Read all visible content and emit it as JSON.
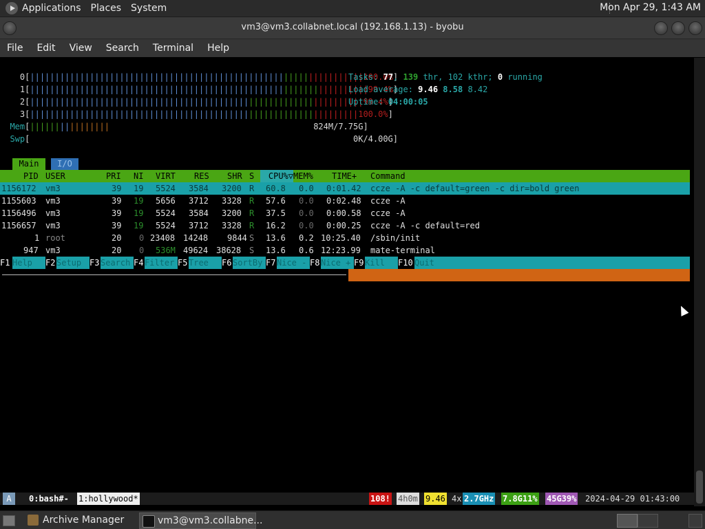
{
  "top_panel": {
    "menus": [
      "Applications",
      "Places",
      "System"
    ],
    "clock": "Mon Apr 29, 1:43 AM"
  },
  "window": {
    "title": "vm3@vm3.collabnet.local (192.168.1.13) - byobu"
  },
  "menubar": [
    "File",
    "Edit",
    "View",
    "Search",
    "Terminal",
    "Help"
  ],
  "htop": {
    "cpu_meters": [
      {
        "id": "0",
        "percent": "100.0%"
      },
      {
        "id": "1",
        "percent": "99.4%"
      },
      {
        "id": "2",
        "percent": "99.4%"
      },
      {
        "id": "3",
        "percent": "100.0%"
      }
    ],
    "mem": {
      "label": "Mem",
      "value": "824M/7.75G"
    },
    "swp": {
      "label": "Swp",
      "value": "0K/4.00G"
    },
    "tasks": {
      "label": "Tasks:",
      "count": "77",
      "thr": "139",
      "thr_label": "thr,",
      "kthr": "102",
      "kthr_label": "kthr;",
      "running": "0",
      "running_label": "running"
    },
    "load_average": {
      "label": "Load average:",
      "v1": "9.46",
      "v5": "8.58",
      "v15": "8.42"
    },
    "uptime": {
      "label": "Uptime:",
      "value": "04:00:05"
    },
    "tabs": [
      "Main",
      "I/O"
    ],
    "columns": [
      "PID",
      "USER",
      "PRI",
      "NI",
      "VIRT",
      "RES",
      "SHR",
      "S",
      "CPU%▽",
      "MEM%",
      "TIME+",
      "Command"
    ],
    "rows": [
      {
        "pid": "1156172",
        "user": "vm3",
        "pri": "39",
        "ni": "19",
        "virt": "5524",
        "res": "3584",
        "shr": "3200",
        "s": "R",
        "cpu": "60.8",
        "mem": "0.0",
        "time": "0:01.42",
        "cmd": "ccze -A -c default=green -c dir=bold green"
      },
      {
        "pid": "1155603",
        "user": "vm3",
        "pri": "39",
        "ni": "19",
        "virt": "5656",
        "res": "3712",
        "shr": "3328",
        "s": "R",
        "cpu": "57.6",
        "mem": "0.0",
        "time": "0:02.48",
        "cmd": "ccze -A"
      },
      {
        "pid": "1156496",
        "user": "vm3",
        "pri": "39",
        "ni": "19",
        "virt": "5524",
        "res": "3584",
        "shr": "3200",
        "s": "R",
        "cpu": "37.5",
        "mem": "0.0",
        "time": "0:00.58",
        "cmd": "ccze -A"
      },
      {
        "pid": "1156657",
        "user": "vm3",
        "pri": "39",
        "ni": "19",
        "virt": "5524",
        "res": "3712",
        "shr": "3328",
        "s": "R",
        "cpu": "16.2",
        "mem": "0.0",
        "time": "0:00.25",
        "cmd": "ccze -A -c default=red"
      },
      {
        "pid": "1",
        "user": "root",
        "pri": "20",
        "ni": "0",
        "virt": "23408",
        "res": "14248",
        "shr": "9844",
        "s": "S",
        "cpu": "13.6",
        "mem": "0.2",
        "time": "10:25.40",
        "cmd": "/sbin/init"
      },
      {
        "pid": "947",
        "user": "vm3",
        "pri": "20",
        "ni": "0",
        "virt": "536M",
        "res": "49624",
        "shr": "38628",
        "s": "S",
        "cpu": "13.6",
        "mem": "0.6",
        "time": "12:23.99",
        "cmd": "mate-terminal"
      }
    ],
    "fkeys": [
      {
        "key": "F1",
        "label": "Help  "
      },
      {
        "key": "F2",
        "label": "Setup "
      },
      {
        "key": "F3",
        "label": "Search"
      },
      {
        "key": "F4",
        "label": "Filter"
      },
      {
        "key": "F5",
        "label": "Tree  "
      },
      {
        "key": "F6",
        "label": "SortBy"
      },
      {
        "key": "F7",
        "label": "Nice -"
      },
      {
        "key": "F8",
        "label": "Nice +"
      },
      {
        "key": "F9",
        "label": "Kill  "
      },
      {
        "key": "F10",
        "label": "Quit"
      }
    ]
  },
  "byobu": {
    "logo": "A",
    "window0": "0:bash#-",
    "window1": "1:hollywood*",
    "updates": "108!",
    "uptime": "4h0m",
    "load": "9.46",
    "cpu_prefix": "4x",
    "cpu_freq": "2.7GHz",
    "mem": "7.8G11%",
    "disk": "45G39%",
    "datetime": "2024-04-29 01:43:00"
  },
  "taskbar": [
    {
      "label": "Archive Manager"
    },
    {
      "label": "vm3@vm3.collabne..."
    }
  ],
  "colors": {
    "htop_green": "#4aa614",
    "htop_cyan": "#1aa0a8",
    "htop_orange": "#d06414",
    "panel_bg": "#2b2b2b"
  }
}
